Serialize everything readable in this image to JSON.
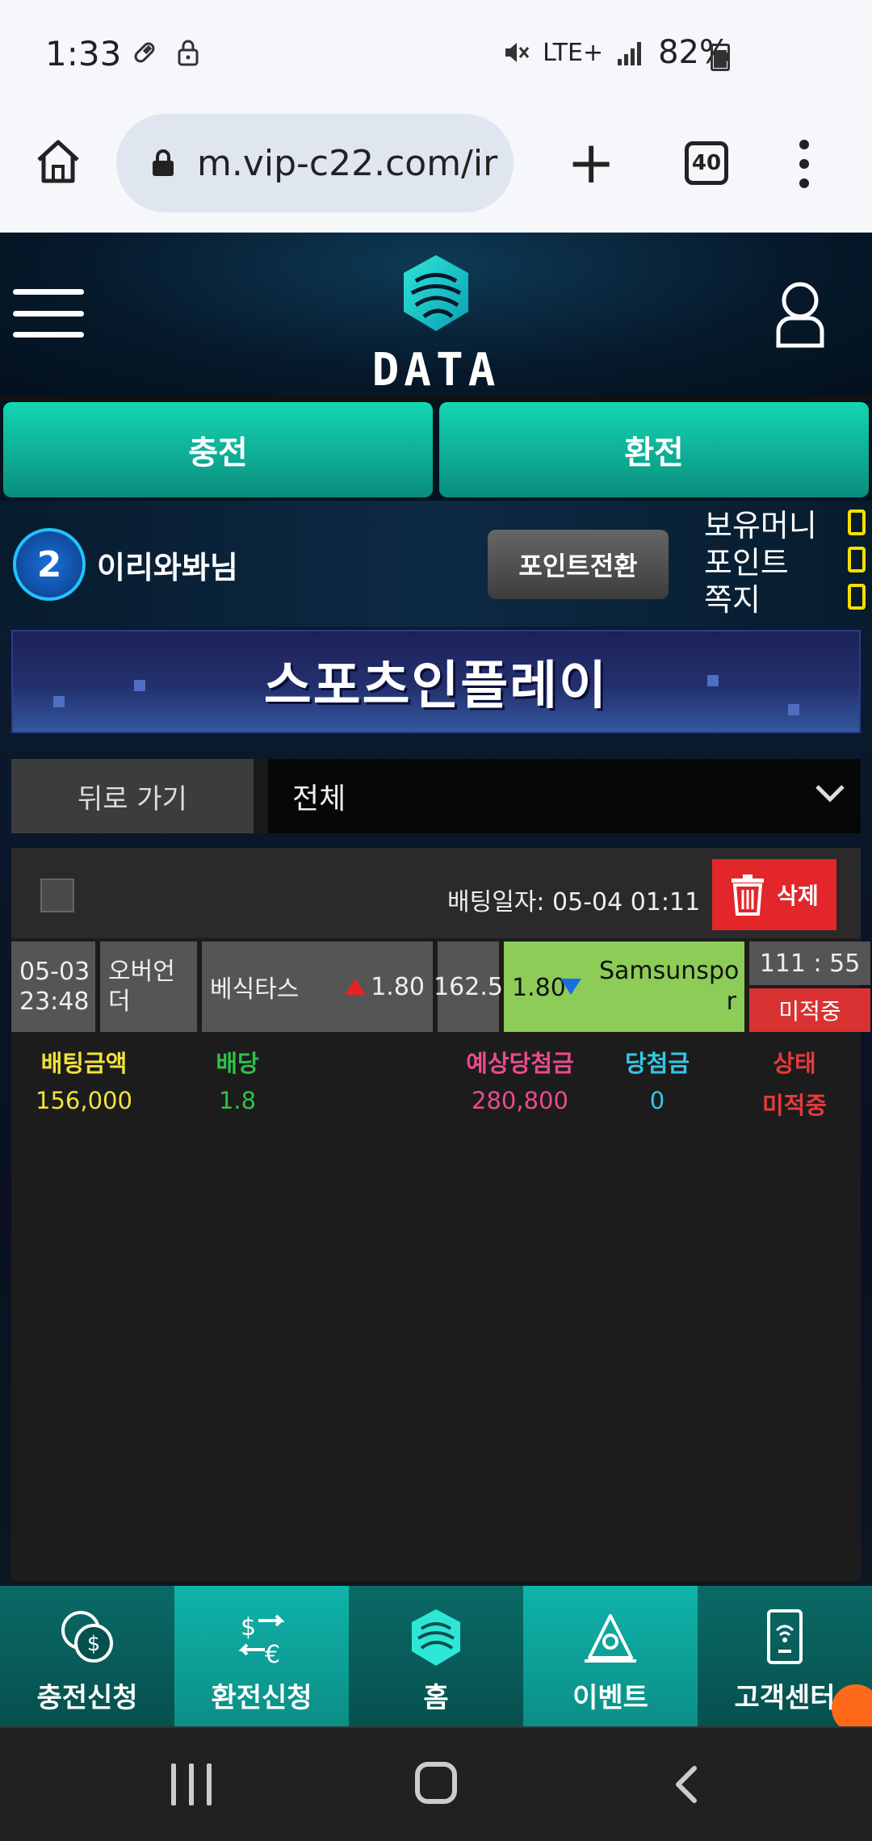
{
  "status_bar": {
    "time": "1:33",
    "network": "LTE+",
    "battery": "82%"
  },
  "browser": {
    "url": "m.vip-c22.com/ir",
    "tab_count": "40"
  },
  "site": {
    "logo_text": "DATA",
    "deposit_label": "충전",
    "withdraw_label": "환전"
  },
  "user": {
    "level": "2",
    "name": "이리와봐님",
    "point_convert_label": "포인트전환",
    "wallet": [
      {
        "label": "보유머니",
        "value": "0"
      },
      {
        "label": "포인트",
        "value": "0"
      },
      {
        "label": "쪽지",
        "value": "0"
      }
    ]
  },
  "banner": {
    "title": "스포츠인플레이"
  },
  "filter": {
    "back_label": "뒤로 가기",
    "selected": "전체"
  },
  "bet": {
    "bet_date": "배팅일자: 05-04 01:11",
    "delete_label": "삭제",
    "game": {
      "date": "05-03",
      "time": "23:48",
      "type_line1": "오버언",
      "type_line2": "더",
      "home_team": "베식타스",
      "home_odds": "1.80",
      "line": "162.5",
      "away_odds": "1.80",
      "away_team_line1": "Samsunspo",
      "away_team_line2": "r",
      "score": "111 : 55",
      "status": "미적중"
    },
    "summary": [
      {
        "label": "배팅금액",
        "value": "156,000",
        "color": "#f2e13a"
      },
      {
        "label": "배당",
        "value": "1.8",
        "color": "#2ec24a"
      },
      {
        "label": "예상당첨금",
        "value": "280,800",
        "color": "#ec4a8c"
      },
      {
        "label": "당첨금",
        "value": "0",
        "color": "#34c7e6"
      },
      {
        "label": "상태",
        "value": "미적중",
        "color": "#e53a3a"
      }
    ]
  },
  "bottom_nav": [
    {
      "label": "충전신청",
      "icon": "coins-icon"
    },
    {
      "label": "환전신청",
      "icon": "currency-exchange-icon"
    },
    {
      "label": "홈",
      "icon": "home-logo-icon"
    },
    {
      "label": "이벤트",
      "icon": "event-icon"
    },
    {
      "label": "고객센터",
      "icon": "customer-center-icon"
    }
  ]
}
